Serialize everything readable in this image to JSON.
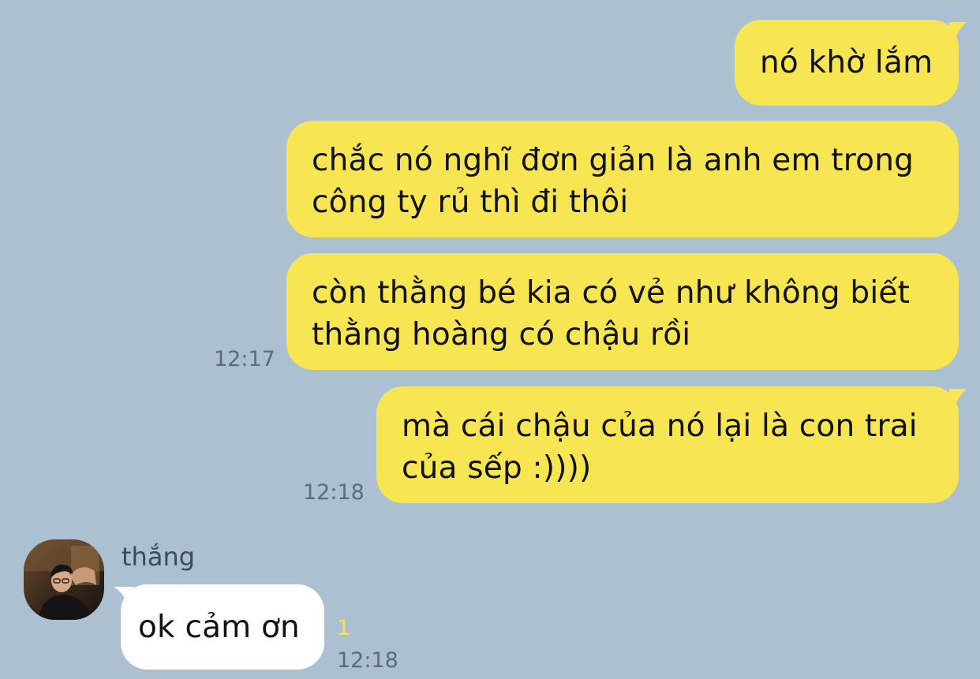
{
  "conversation": {
    "messages": [
      {
        "direction": "outgoing",
        "text": "nó khờ lắm",
        "time": ""
      },
      {
        "direction": "outgoing",
        "text": "chắc nó nghĩ đơn giản là anh em trong\ncông ty rủ thì đi thôi",
        "time": ""
      },
      {
        "direction": "outgoing",
        "text": "còn thằng bé kia có vẻ như không biết\nthằng hoàng có chậu rồi",
        "time": "12:17"
      },
      {
        "direction": "outgoing",
        "text": "mà cái chậu của nó lại là con trai\ncủa sếp :))))",
        "time": "12:18"
      },
      {
        "direction": "incoming",
        "sender": "thắng",
        "text": "ok cảm ơn",
        "time": "12:18",
        "unread_count": "1"
      }
    ]
  },
  "colors": {
    "background": "#abc1d1",
    "outgoing_bubble": "#f8e552",
    "incoming_bubble": "#ffffff",
    "unread_count": "#f6e24d",
    "timestamp": "#5f6c77"
  },
  "icons": {
    "avatar": "user-photo-avatar"
  }
}
